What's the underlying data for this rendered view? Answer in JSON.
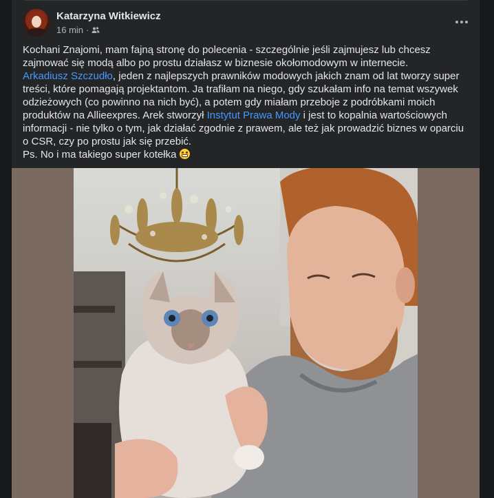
{
  "post": {
    "author": "Katarzyna Witkiewicz",
    "time": "16 min",
    "separator": "·",
    "audience_icon": "friends-icon",
    "more_icon": "more-dots-icon",
    "body": {
      "line1": "Kochani Znajomi, mam fajną stronę do polecenia - szczególnie jeśli zajmujesz lub chcesz zajmować się modą albo po prostu działasz w biznesie okołomodowym w internecie.",
      "mention": "Arkadiusz Szczudło",
      "line2": ", jeden z najlepszych prawników modowych jakich znam od lat tworzy super treści, które pomagają projektantom. Ja trafiłam na niego, gdy szukałam info na temat wszywek odzieżowych (co powinno na nich być), a potem gdy miałam przeboje z podróbkami moich produktów na Allieexpres. Arek stworzył ",
      "link": "Instytut Prawa Mody",
      "line3": " i jest to kopalnia wartościowych informacji - nie tylko o tym, jak działać zgodnie z prawem, ale też jak prowadzić biznes w oparciu o CSR, czy po prostu jak się przebić.",
      "ps": "Ps. No i ma takiego super kotełka ",
      "emoji": "grimacing-face-emoji"
    }
  },
  "colors": {
    "background": "#18191a",
    "card": "#242526",
    "text": "#e4e6eb",
    "secondary_text": "#b0b3b8",
    "link": "#4599ff"
  }
}
